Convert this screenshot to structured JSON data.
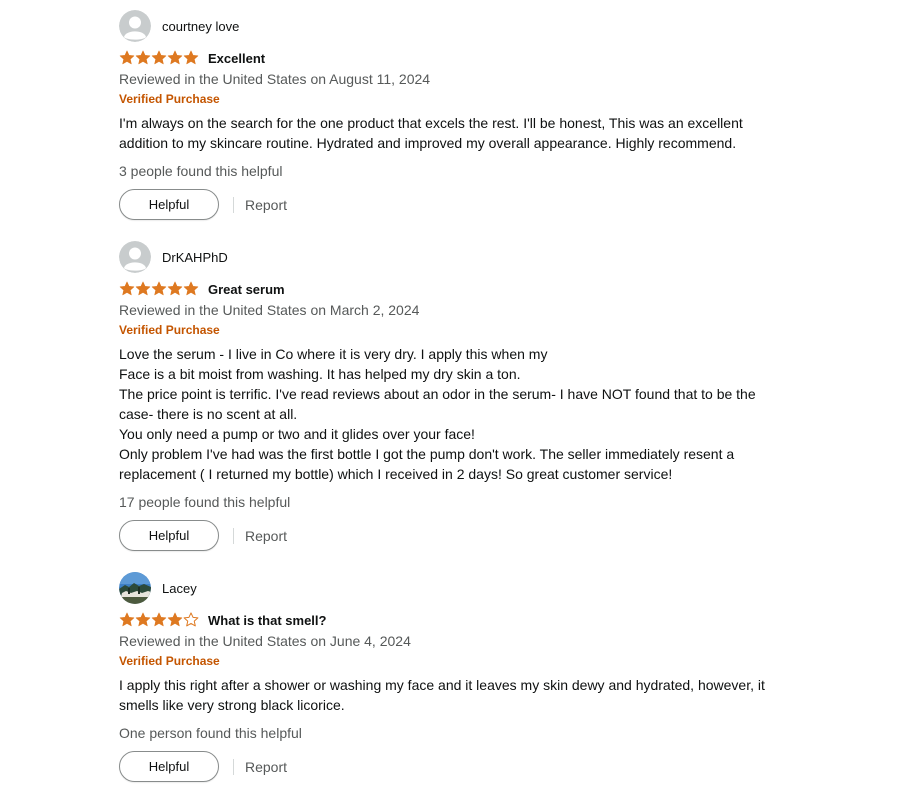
{
  "colors": {
    "star": "#de7921",
    "verified": "#c45500",
    "secondary_text": "#565959",
    "primary_text": "#0f1111"
  },
  "reviews": [
    {
      "author": "courtney love",
      "avatar_icon": "default-avatar-icon",
      "rating": 5,
      "title": "Excellent",
      "date": "Reviewed in the United States on August 11, 2024",
      "verified": "Verified Purchase",
      "body_lines": [
        "I'm always on the search for the one product that excels the rest. I'll be honest, This was an excellent",
        "addition to my skincare routine. Hydrated and improved my overall appearance. Highly recommend."
      ],
      "helpful_text": "3 people found this helpful",
      "helpful_button": "Helpful",
      "report_label": "Report"
    },
    {
      "author": "DrKAHPhD",
      "avatar_icon": "default-avatar-icon",
      "rating": 5,
      "title": "Great serum",
      "date": "Reviewed in the United States on March 2, 2024",
      "verified": "Verified Purchase",
      "body_lines": [
        "Love the serum - I live in Co where it is very dry. I apply this when my",
        "Face is a bit moist from washing. It has helped my dry skin a ton.",
        "The price point is terrific. I've read reviews about an odor in the serum- I have NOT found that to be the",
        "case- there is no scent at all.",
        "You only need a pump or two and it glides over your face!",
        "Only problem I've had was the first bottle I got the pump don't work. The seller immediately resent a",
        "replacement ( I returned my bottle) which I received in 2 days! So great customer service!"
      ],
      "helpful_text": "17 people found this helpful",
      "helpful_button": "Helpful",
      "report_label": "Report"
    },
    {
      "author": "Lacey",
      "avatar_icon": "photo-avatar-icon",
      "rating": 4,
      "title": "What is that smell?",
      "date": "Reviewed in the United States on June 4, 2024",
      "verified": "Verified Purchase",
      "body_lines": [
        "I apply this right after a shower or washing my face and it leaves my skin dewy and hydrated, however, it",
        "smells like very strong black licorice."
      ],
      "helpful_text": "One person found this helpful",
      "helpful_button": "Helpful",
      "report_label": "Report"
    }
  ]
}
